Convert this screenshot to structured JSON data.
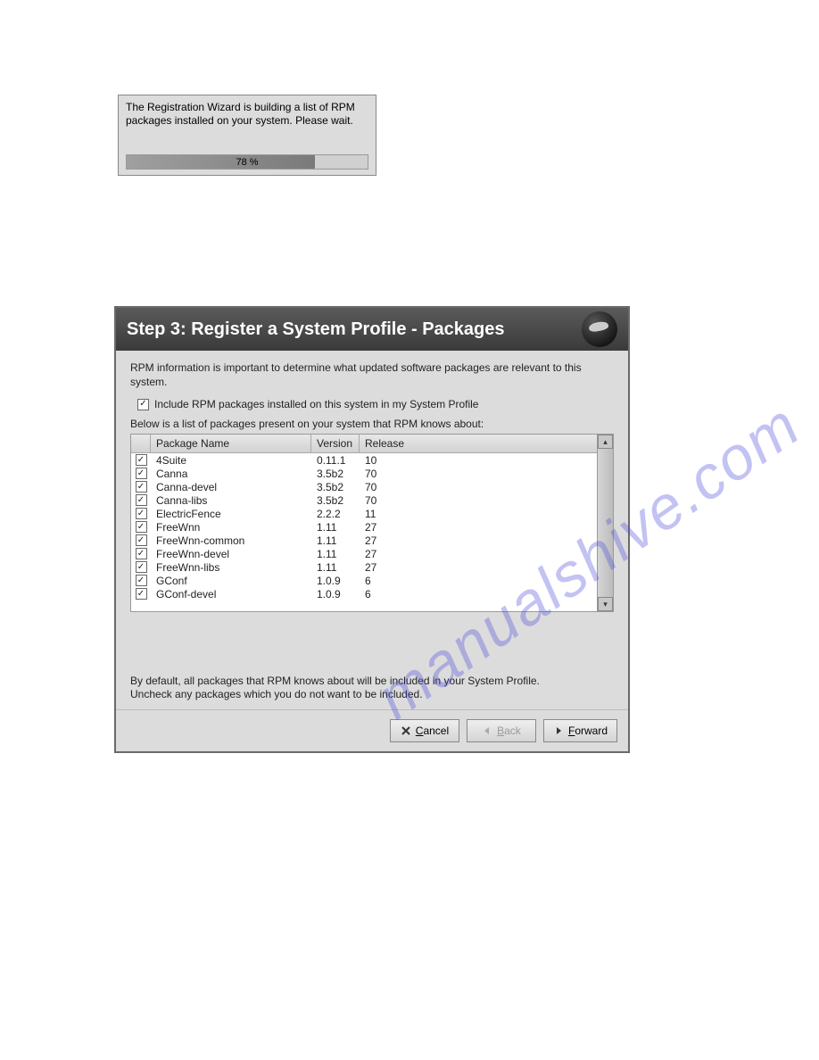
{
  "progress": {
    "text": "The Registration Wizard is building a list of RPM packages installed on your system.  Please wait.",
    "percent_label": "78 %",
    "percent_value": 78
  },
  "wizard": {
    "title": "Step 3: Register a System Profile - Packages",
    "info": "RPM information is important to determine what updated software packages are relevant to this system.",
    "include_label": "Include RPM packages installed on this system in my System Profile",
    "include_checked": true,
    "list_label": "Below is a list of packages present on your system that RPM knows about:",
    "columns": {
      "c1": "Package Name",
      "c2": "Version",
      "c3": "Release"
    },
    "packages": [
      {
        "checked": true,
        "name": "4Suite",
        "version": "0.11.1",
        "release": "10"
      },
      {
        "checked": true,
        "name": "Canna",
        "version": "3.5b2",
        "release": "70"
      },
      {
        "checked": true,
        "name": "Canna-devel",
        "version": "3.5b2",
        "release": "70"
      },
      {
        "checked": true,
        "name": "Canna-libs",
        "version": "3.5b2",
        "release": "70"
      },
      {
        "checked": true,
        "name": "ElectricFence",
        "version": "2.2.2",
        "release": "11"
      },
      {
        "checked": true,
        "name": "FreeWnn",
        "version": "1.11",
        "release": "27"
      },
      {
        "checked": true,
        "name": "FreeWnn-common",
        "version": "1.11",
        "release": "27"
      },
      {
        "checked": true,
        "name": "FreeWnn-devel",
        "version": "1.11",
        "release": "27"
      },
      {
        "checked": true,
        "name": "FreeWnn-libs",
        "version": "1.11",
        "release": "27"
      },
      {
        "checked": true,
        "name": "GConf",
        "version": "1.0.9",
        "release": "6"
      },
      {
        "checked": true,
        "name": "GConf-devel",
        "version": "1.0.9",
        "release": "6"
      }
    ],
    "footer_note_1": "By default, all packages that RPM knows about will be included in your System Profile.",
    "footer_note_2": "Uncheck any packages which you do not want to be included.",
    "buttons": {
      "cancel": "Cancel",
      "back": "Back",
      "forward": "Forward"
    }
  },
  "watermark": "manualshive.com"
}
